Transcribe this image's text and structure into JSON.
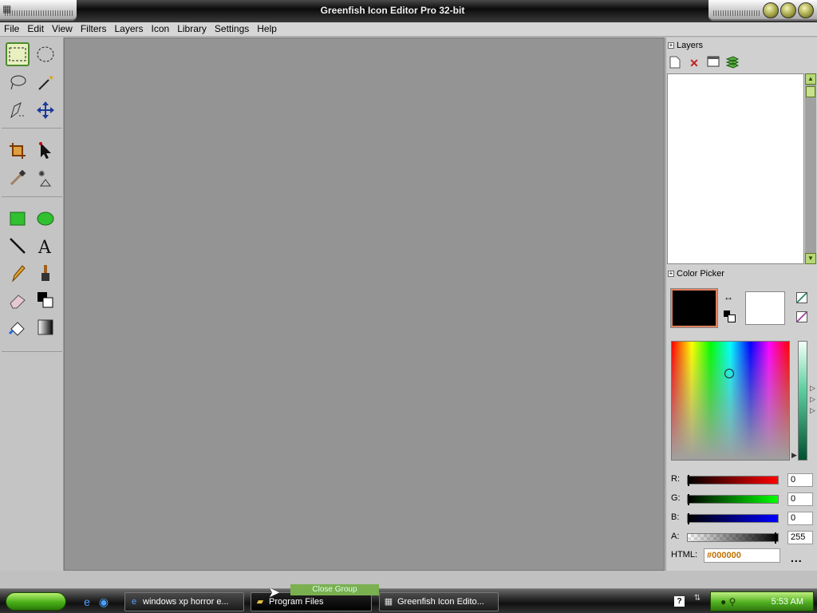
{
  "window": {
    "title": "Greenfish Icon Editor Pro 32-bit"
  },
  "menu": [
    "File",
    "Edit",
    "View",
    "Filters",
    "Layers",
    "Icon",
    "Library",
    "Settings",
    "Help"
  ],
  "panels": {
    "layers_title": "Layers",
    "color_picker_title": "Color Picker"
  },
  "color": {
    "primary": "#000000",
    "secondary": "#FFFFFF",
    "r_label": "R:",
    "g_label": "G:",
    "b_label": "B:",
    "a_label": "A:",
    "r": "0",
    "g": "0",
    "b": "0",
    "a": "255",
    "r_fraction": 0,
    "g_fraction": 0,
    "b_fraction": 0,
    "a_fraction": 1,
    "html_label": "HTML:",
    "html": "#000000",
    "more": "..."
  },
  "taskbar": {
    "tasks": [
      "windows xp horror e...",
      "Program Files",
      "Greenfish Icon Edito..."
    ],
    "tooltip": "Close Group",
    "clock": "5:53 AM",
    "help": "?"
  }
}
